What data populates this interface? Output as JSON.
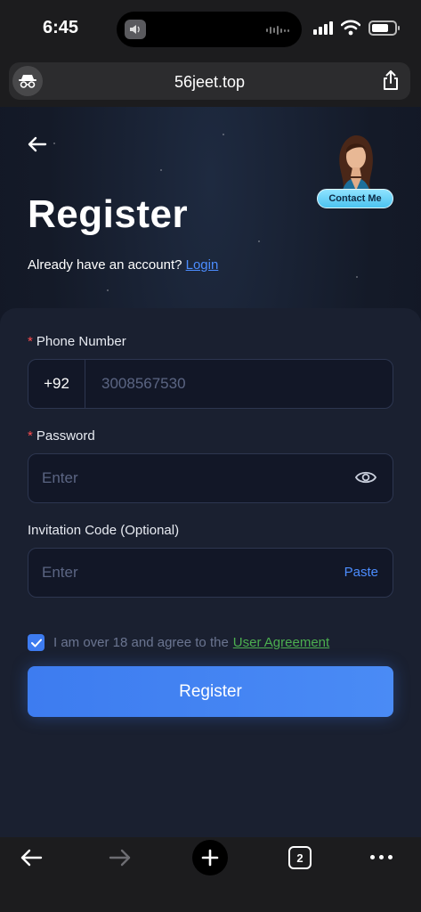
{
  "status_bar": {
    "time": "6:45"
  },
  "browser": {
    "url": "56jeet.top",
    "tab_count": "2"
  },
  "header": {
    "contact_label": "Contact Me",
    "title": "Register",
    "have_account_text": "Already have an account?",
    "login_link": "Login"
  },
  "form": {
    "phone": {
      "label": "Phone Number",
      "prefix": "+92",
      "placeholder": "3008567530"
    },
    "password": {
      "label": "Password",
      "placeholder": "Enter"
    },
    "invitation": {
      "label": "Invitation Code (Optional)",
      "placeholder": "Enter",
      "paste_label": "Paste"
    },
    "agreement": {
      "checked": true,
      "text": "I am over 18 and agree to the",
      "link": "User Agreement"
    },
    "submit_label": "Register"
  },
  "colors": {
    "accent": "#3d7cf0",
    "link": "#4c8dff",
    "agreement_link": "#4caf50",
    "required": "#ff4d4f",
    "background": "#141a28"
  }
}
